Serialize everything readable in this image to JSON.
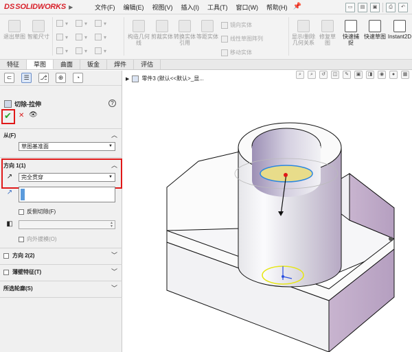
{
  "app": {
    "brand_prefix": "DS",
    "brand_name": "SOLIDWORKS"
  },
  "menu": [
    "文件(F)",
    "编辑(E)",
    "视图(V)",
    "插入(I)",
    "工具(T)",
    "窗口(W)",
    "帮助(H)"
  ],
  "commands": {
    "exit_sketch": "退出草图",
    "smart_dim": "智能尺寸",
    "construct_geo": "构造几何线",
    "trim": "剪裁实体",
    "convert": "转换实体引用",
    "offset": "等距实体",
    "mirror": "镜向实体",
    "linear_pattern": "线性草图阵列",
    "move": "移动实体",
    "display_delete": "显示/删除几何关系",
    "repair": "修复草图",
    "quick_snap": "快速捕捉",
    "quick_sketch": "快速草图",
    "instant2d": "Instant2D"
  },
  "tabs": [
    "特征",
    "草图",
    "曲面",
    "钣金",
    "焊件",
    "评估"
  ],
  "active_tab": "草图",
  "panel": {
    "feature_title": "切除-拉伸",
    "from_label": "从(F)",
    "from_value": "草图基准面",
    "dir1_label": "方向 1(1)",
    "dir1_value": "完全贯穿",
    "flip_side": "反侧切除(F)",
    "draft_outward": "向外拔模(O)",
    "dir2_label": "方向 2(2)",
    "thin_label": "薄壁特征(T)",
    "contours_label": "所选轮廓(S)"
  },
  "viewport": {
    "tree_label": "零件3 (默认<<默认>_显..."
  }
}
